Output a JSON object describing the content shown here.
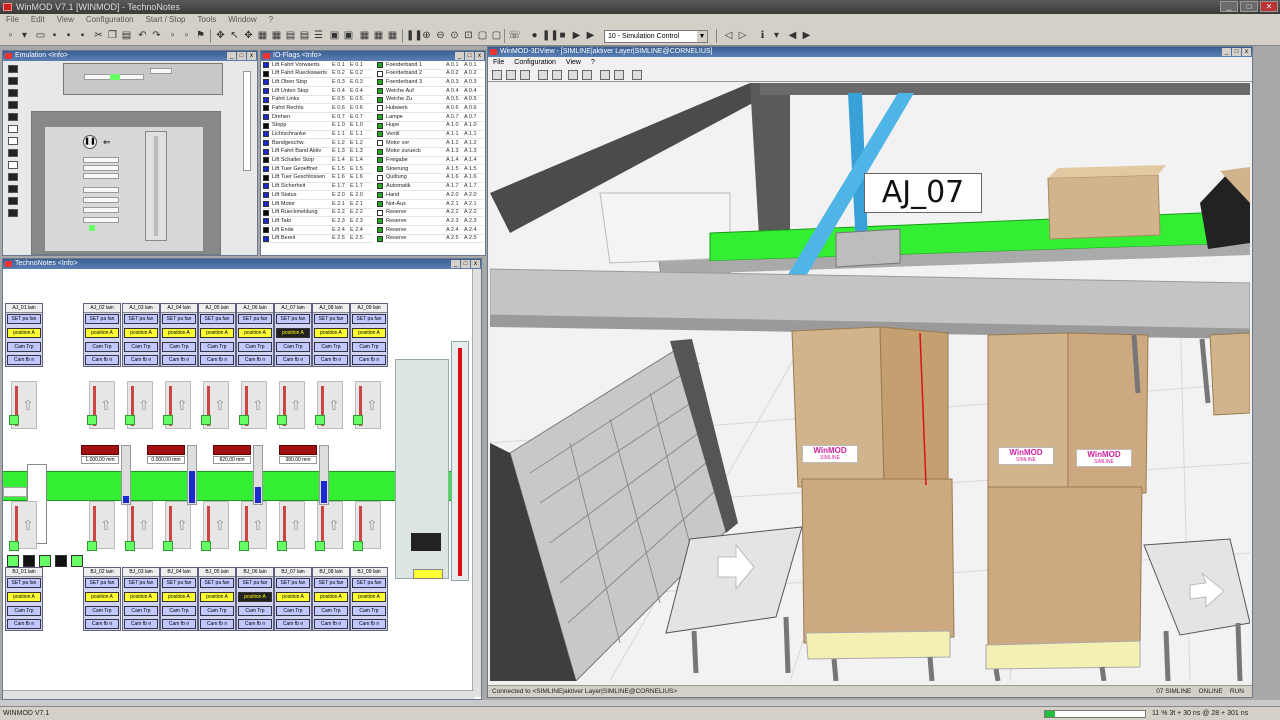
{
  "app": {
    "title": "WinMOD V7.1 [WINMOD] - TechnoNotes",
    "status_left": "WINMOD V7.1",
    "status_right": "11 % 3t + 30 ns @ 28 + 301 ns",
    "progress": 0.1
  },
  "menu": [
    "File",
    "Edit",
    "View",
    "Configuration",
    "Start / Stop",
    "Tools",
    "Window",
    "?"
  ],
  "toolbar": {
    "simulation_select": "10 - Simulation Control"
  },
  "windows": {
    "emulation": {
      "title": "Emulation <Info>"
    },
    "io": {
      "title": "IO-Flags <Info>"
    },
    "technonotes": {
      "title": "TechnoNotes <Info>"
    },
    "view3d": {
      "title": "WinMOD-3DView - [SIMLINE|aktiver Layer|SIMLINE@CORNELIUS]",
      "menu": [
        "File",
        "Configuration",
        "View",
        "?"
      ],
      "status_left": "Connected to <SIMLINE|aktiver Layer|SIMLINE@CORNELIUS>",
      "status_right": [
        "07 SIMLINE",
        "ONLINE",
        "RUN"
      ]
    }
  },
  "scene": {
    "selected_label": "AJ_07",
    "box_logo_line1": "WinMOD",
    "box_logo_line2": "SIMLINE"
  },
  "io_rows": [
    {
      "name": "Lift Fahrt Vorwaerts",
      "addr": "E 0.1",
      "val": "E 0.1"
    },
    {
      "name": "Lift Fahrt Rueckwaerts",
      "addr": "E 0.2",
      "val": "E 0.2"
    },
    {
      "name": "Lift Oben Stop",
      "addr": "E 0.3",
      "val": "E 0.3"
    },
    {
      "name": "Lift Unten Stop",
      "addr": "E 0.4",
      "val": "E 0.4"
    },
    {
      "name": "Fahrt Links",
      "addr": "E 0.5",
      "val": "E 0.5"
    },
    {
      "name": "Fahrt Rechts",
      "addr": "E 0.6",
      "val": "E 0.6"
    },
    {
      "name": "Drehen",
      "addr": "E 0.7",
      "val": "E 0.7"
    },
    {
      "name": "Stopp",
      "addr": "E 1.0",
      "val": "E 1.0"
    },
    {
      "name": "Lichtschranke",
      "addr": "E 1.1",
      "val": "E 1.1"
    },
    {
      "name": "Bandgeschw.",
      "addr": "E 1.2",
      "val": "E 1.2"
    },
    {
      "name": "Lift Fahrt Band Aktiv",
      "addr": "E 1.3",
      "val": "E 1.3"
    },
    {
      "name": "Lift Schalter Stop",
      "addr": "E 1.4",
      "val": "E 1.4"
    },
    {
      "name": "Lift Tuer Geoeffnet",
      "addr": "E 1.5",
      "val": "E 1.5"
    },
    {
      "name": "Lift Tuer Geschlossen",
      "addr": "E 1.6",
      "val": "E 1.6"
    },
    {
      "name": "Lift Sicherheit",
      "addr": "E 1.7",
      "val": "E 1.7"
    },
    {
      "name": "Lift Status",
      "addr": "E 2.0",
      "val": "E 2.0"
    },
    {
      "name": "Lift Motor",
      "addr": "E 2.1",
      "val": "E 2.1"
    },
    {
      "name": "Lift Rueckmeldung",
      "addr": "E 2.2",
      "val": "E 2.2"
    },
    {
      "name": "Lift Takt",
      "addr": "E 2.3",
      "val": "E 2.3"
    },
    {
      "name": "Lift Ende",
      "addr": "E 2.4",
      "val": "E 2.4"
    },
    {
      "name": "Lift Bereit",
      "addr": "E 2.5",
      "val": "E 2.5"
    }
  ],
  "io_rows_right": [
    {
      "name": "Foerderband 1",
      "addr": "A 0.1",
      "val": "A 0.1"
    },
    {
      "name": "Foerderband 2",
      "addr": "A 0.2",
      "val": "A 0.2"
    },
    {
      "name": "Foerderband 3",
      "addr": "A 0.3",
      "val": "A 0.3"
    },
    {
      "name": "Weiche Auf",
      "addr": "A 0.4",
      "val": "A 0.4"
    },
    {
      "name": "Weiche Zu",
      "addr": "A 0.5",
      "val": "A 0.5"
    },
    {
      "name": "Hubwerk",
      "addr": "A 0.6",
      "val": "A 0.6"
    },
    {
      "name": "Lampe",
      "addr": "A 0.7",
      "val": "A 0.7"
    },
    {
      "name": "Hupe",
      "addr": "A 1.0",
      "val": "A 1.0"
    },
    {
      "name": "Ventil",
      "addr": "A 1.1",
      "val": "A 1.1"
    },
    {
      "name": "Motor vor",
      "addr": "A 1.2",
      "val": "A 1.2"
    },
    {
      "name": "Motor zurueck",
      "addr": "A 1.3",
      "val": "A 1.3"
    },
    {
      "name": "Freigabe",
      "addr": "A 1.4",
      "val": "A 1.4"
    },
    {
      "name": "Stoerung",
      "addr": "A 1.5",
      "val": "A 1.5"
    },
    {
      "name": "Quittung",
      "addr": "A 1.6",
      "val": "A 1.6"
    },
    {
      "name": "Automatik",
      "addr": "A 1.7",
      "val": "A 1.7"
    },
    {
      "name": "Hand",
      "addr": "A 2.0",
      "val": "A 2.0"
    },
    {
      "name": "Not-Aus",
      "addr": "A 2.1",
      "val": "A 2.1"
    },
    {
      "name": "Reserve",
      "addr": "A 2.2",
      "val": "A 2.2"
    },
    {
      "name": "Reserve",
      "addr": "A 2.3",
      "val": "A 2.3"
    },
    {
      "name": "Reserve",
      "addr": "A 2.4",
      "val": "A 2.4"
    },
    {
      "name": "Reserve",
      "addr": "A 2.5",
      "val": "A 2.5"
    }
  ],
  "tn_top_blocks": [
    {
      "title": "AJ_01 lain",
      "a": "SET pa fan",
      "y": "position A",
      "b1": "Cam Trp",
      "b2": "Cam fb n"
    },
    {
      "title": "AJ_02 lain",
      "a": "SET pa fan",
      "y": "position A",
      "b1": "Cam Trp",
      "b2": "Cam fb n"
    },
    {
      "title": "AJ_03 lain",
      "a": "SET pa fan",
      "y": "position A",
      "b1": "Cam Trp",
      "b2": "Cam fb n"
    },
    {
      "title": "AJ_04 lain",
      "a": "SET pa fan",
      "y": "position A",
      "b1": "Cam Trp",
      "b2": "Cam fb n"
    },
    {
      "title": "AJ_05 lain",
      "a": "SET pa fan",
      "y": "position A",
      "b1": "Cam Trp",
      "b2": "Cam fb n"
    },
    {
      "title": "AJ_06 lain",
      "a": "SET pa fan",
      "y": "position A",
      "b1": "Cam Trp",
      "b2": "Cam fb n"
    },
    {
      "title": "AJ_07 lain",
      "a": "SET pa fan",
      "y": "position A",
      "b1": "Cam Trp",
      "b2": "Cam fb n"
    },
    {
      "title": "AJ_08 lain",
      "a": "SET pa fan",
      "y": "position A",
      "b1": "Cam Trp",
      "b2": "Cam fb n"
    },
    {
      "title": "AJ_09 lain",
      "a": "SET pa fan",
      "y": "position A",
      "b1": "Cam Trp",
      "b2": "Cam fb n"
    }
  ],
  "tn_bottom_blocks": [
    {
      "title": "BJ_01 lain",
      "a": "SET pa fan",
      "y": "position A",
      "b1": "Cam Trp",
      "b2": "Cam fb n"
    },
    {
      "title": "BJ_02 lain",
      "a": "SET pa fan",
      "y": "position A",
      "b1": "Cam Trp",
      "b2": "Cam fb n"
    },
    {
      "title": "BJ_03 lain",
      "a": "SET pa fan",
      "y": "position A",
      "b1": "Cam Trp",
      "b2": "Cam fb n"
    },
    {
      "title": "BJ_04 lain",
      "a": "SET pa fan",
      "y": "position A",
      "b1": "Cam Trp",
      "b2": "Cam fb n"
    },
    {
      "title": "BJ_05 lain",
      "a": "SET pa fan",
      "y": "position A",
      "b1": "Cam Trp",
      "b2": "Cam fb n"
    },
    {
      "title": "BJ_06 lain",
      "a": "SET pa fan",
      "y": "position A",
      "b1": "Cam Trp",
      "b2": "Cam fb n"
    },
    {
      "title": "BJ_07 lain",
      "a": "SET pa fan",
      "y": "position A",
      "b1": "Cam Trp",
      "b2": "Cam fb n"
    },
    {
      "title": "BJ_08 lain",
      "a": "SET pa fan",
      "y": "position A",
      "b1": "Cam Trp",
      "b2": "Cam fb n"
    },
    {
      "title": "BJ_09 lain",
      "a": "SET pa fan",
      "y": "position A",
      "b1": "Cam Trp",
      "b2": "Cam fb n"
    }
  ],
  "tn_values": [
    "1.000,00 mm",
    "0.000,00 mm",
    "820,00 mm",
    "380,00 mm"
  ],
  "colors": {
    "conveyor_green": "#33ee33",
    "io_blue": "#1a2ad0",
    "title_blue": "#3a5f95",
    "box_brown": "#d2b48c",
    "logo_magenta": "#d0229c"
  }
}
